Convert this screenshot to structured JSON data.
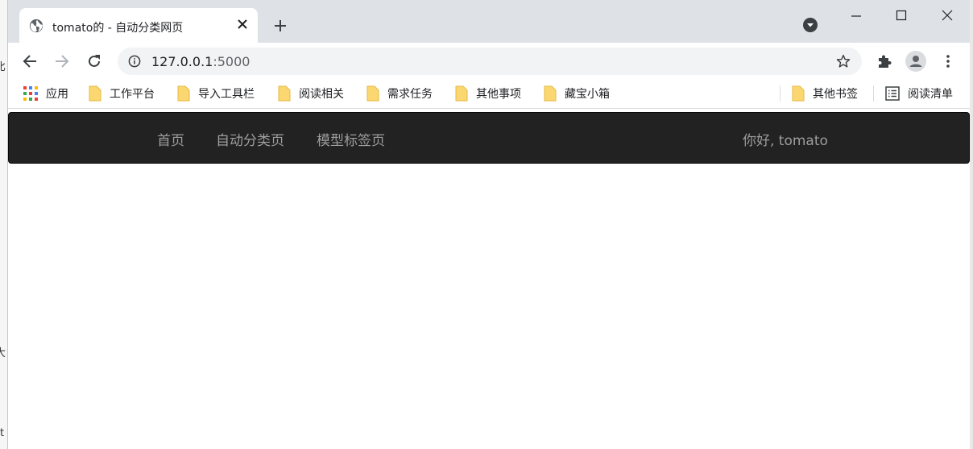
{
  "tab": {
    "title": "tomato的 - 自动分类网页"
  },
  "omnibox": {
    "host": "127.0.0.1",
    "port": ":5000"
  },
  "bookmarks": {
    "apps": "应用",
    "items": [
      "工作平台",
      "导入工具栏",
      "阅读相关",
      "需求任务",
      "其他事项",
      "藏宝小箱"
    ],
    "other": "其他书签",
    "reading_list": "阅读清单"
  },
  "navbar": {
    "links": [
      "首页",
      "自动分类页",
      "模型标签页"
    ],
    "greeting": "你好, tomato"
  },
  "background_window": {
    "fragments": [
      "比",
      "大",
      "t"
    ]
  },
  "colors": {
    "navbar_bg": "#222222",
    "nav_link": "#9d9d9d",
    "tabstrip": "#dee1e6",
    "folder": "#fbd771"
  },
  "icons": [
    "globe-icon",
    "close-icon",
    "plus-icon",
    "tab-search-icon",
    "minimize-icon",
    "maximize-icon",
    "window-close-icon",
    "back-icon",
    "forward-icon",
    "reload-icon",
    "info-icon",
    "star-icon",
    "extensions-icon",
    "profile-icon",
    "menu-icon",
    "apps-icon",
    "folder-icon",
    "reading-list-icon"
  ]
}
